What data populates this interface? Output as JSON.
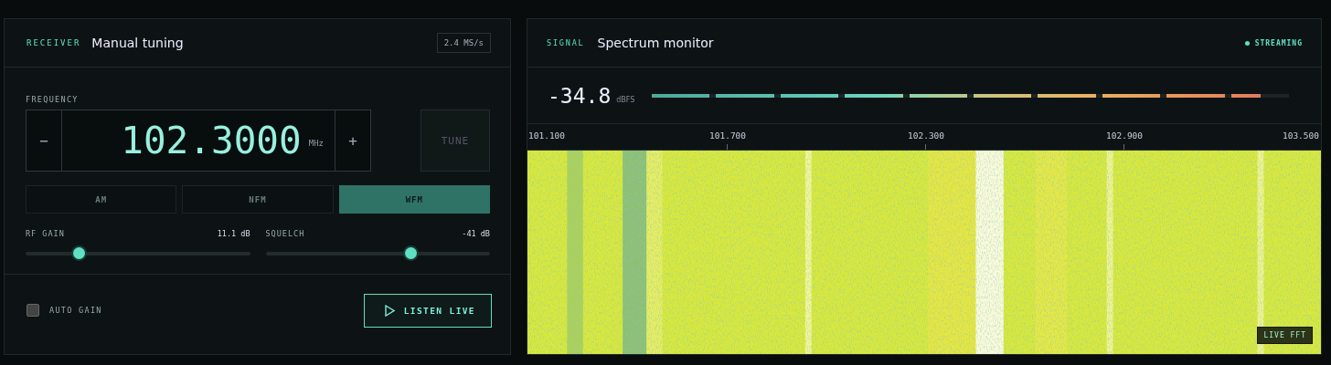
{
  "receiver": {
    "eyebrow": "RECEIVER",
    "title": "Manual tuning",
    "sample_rate": "2.4 MS/s",
    "frequency_label": "FREQUENCY",
    "decrement": "−",
    "frequency": "102.3000",
    "unit": "MHz",
    "increment": "+",
    "tune": "TUNE",
    "modes": [
      {
        "label": "AM",
        "selected": false
      },
      {
        "label": "NFM",
        "selected": false
      },
      {
        "label": "WFM",
        "selected": true
      }
    ],
    "sliders": [
      {
        "label": "RF GAIN",
        "reading": "11.1 dB",
        "level": 0.237
      },
      {
        "label": "SQUELCH",
        "reading": "-41 dB",
        "level": 0.646
      }
    ],
    "auto_gain": {
      "label": "AUTO GAIN",
      "checked": false
    },
    "listen": "LISTEN LIVE"
  },
  "spectrum": {
    "eyebrow": "SIGNAL",
    "title": "Spectrum monitor",
    "status": "STREAMING",
    "reading": "-34.8",
    "reading_unit": "dBFS",
    "level": 0.955,
    "axis": [
      "101.100",
      "101.700",
      "102.300",
      "102.900",
      "103.500"
    ],
    "badge": "LIVE FFT"
  }
}
